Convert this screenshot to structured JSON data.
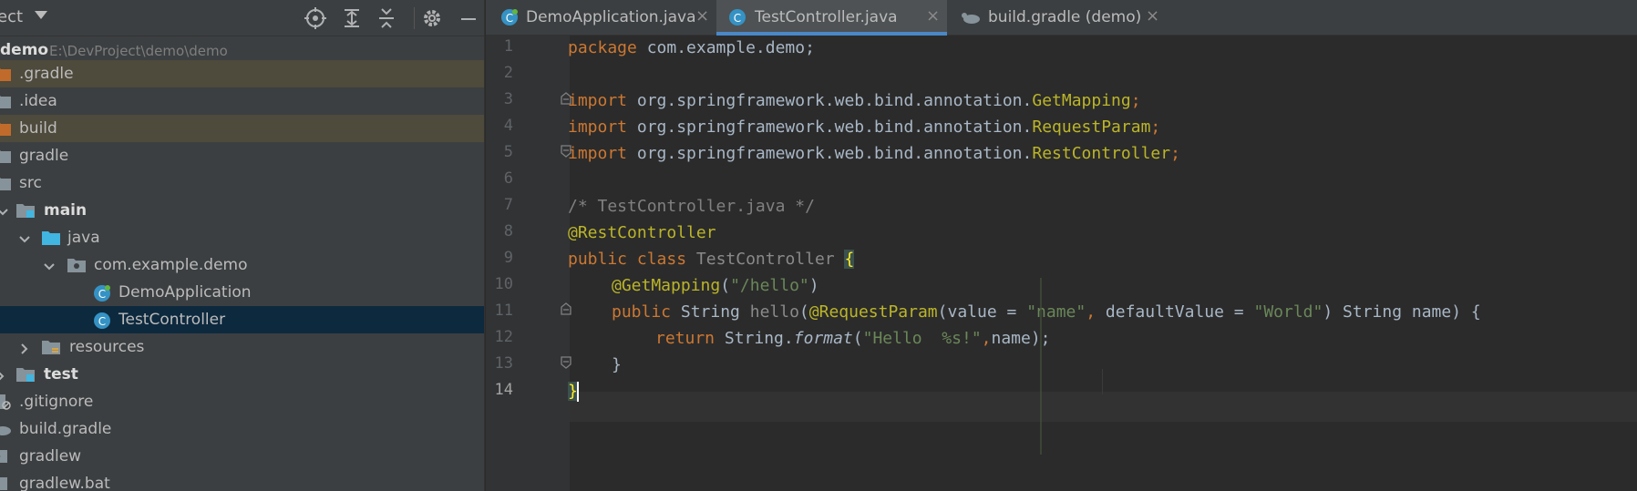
{
  "project_panel": {
    "title": "ject",
    "root": {
      "name": "demo",
      "path": "E:\\DevProject\\demo\\demo"
    },
    "items": [
      {
        "label": ".gradle"
      },
      {
        "label": ".idea"
      },
      {
        "label": "build"
      },
      {
        "label": "gradle"
      },
      {
        "label": "src"
      },
      {
        "label": "main"
      },
      {
        "label": "java"
      },
      {
        "label": "com.example.demo"
      },
      {
        "label": "DemoApplication"
      },
      {
        "label": "TestController"
      },
      {
        "label": "resources"
      },
      {
        "label": "test"
      },
      {
        "label": ".gitignore"
      },
      {
        "label": "build.gradle"
      },
      {
        "label": "gradlew"
      },
      {
        "label": "gradlew.bat"
      }
    ]
  },
  "tabs": [
    {
      "label": "DemoApplication.java",
      "close": "×"
    },
    {
      "label": "TestController.java",
      "close": "×"
    },
    {
      "label": "build.gradle (demo)",
      "close": "×"
    }
  ],
  "editor": {
    "line_numbers": [
      "1",
      "2",
      "3",
      "4",
      "5",
      "6",
      "7",
      "8",
      "9",
      "10",
      "11",
      "12",
      "13",
      "14"
    ],
    "code": {
      "l1_kw": "package",
      "l1_rest": " com.example.demo;",
      "import_kw": "import",
      "l3_pkg": " org.springframework.web.bind.annotation.",
      "l3_cls": "GetMapping",
      "semi": ";",
      "l4_cls": "RequestParam",
      "l5_cls": "RestController",
      "l7_comment": "/* TestController.java */",
      "l8_annotation": "@RestController",
      "l9_public": "public",
      "l9_class": "class",
      "l9_name": "TestController",
      "l9_brace": "{",
      "l10_annotation": "@GetMapping",
      "l10_open": "(",
      "l10_str": "\"/hello\"",
      "l10_close": ")",
      "l11_public": "public",
      "l11_string": " String ",
      "l11_method": "hello",
      "l11_open": "(",
      "l11_annotation": "@RequestParam",
      "l11_value": "(value = ",
      "l11_str1": "\"name\"",
      "l11_comma": ", ",
      "l11_default": "defaultValue = ",
      "l11_str2": "\"World\"",
      "l11_tail": ") String name) {",
      "l12_return": "return",
      "l12_string": " String.",
      "l12_format": "format",
      "l12_open": "(",
      "l12_str": "\"Hello  %s!\"",
      "l12_comma": ",",
      "l12_tail": "name);",
      "l13_brace": "}",
      "l14_brace": "}"
    }
  },
  "colors": {
    "keyword": "#cc7832",
    "annotation": "#bbb529",
    "string": "#6a8759",
    "comment": "#808080",
    "accent": "#4a88c7",
    "selection": "#0d293e",
    "excluded": "#4e4a3c"
  }
}
